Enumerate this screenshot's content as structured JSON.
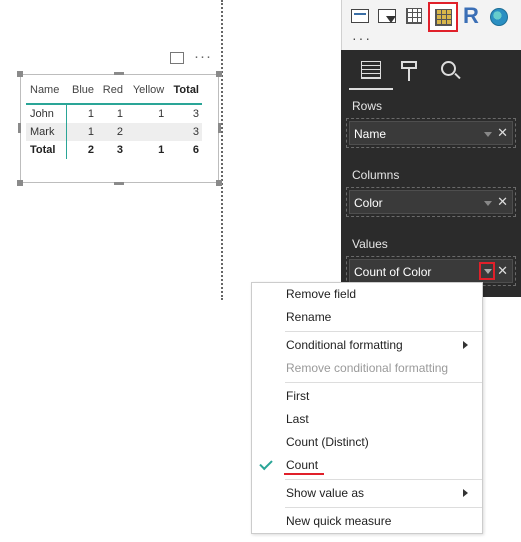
{
  "visual": {
    "matrix": {
      "headers": [
        "Name",
        "Blue",
        "Red",
        "Yellow",
        "Total"
      ],
      "rows": [
        [
          "John",
          "1",
          "1",
          "1",
          "3"
        ],
        [
          "Mark",
          "1",
          "2",
          "",
          "3"
        ]
      ],
      "total_row": [
        "Total",
        "2",
        "3",
        "1",
        "6"
      ]
    },
    "header_icons": {
      "focus": "focus-mode-icon",
      "more": "···"
    }
  },
  "visualizations": {
    "selected": "matrix-icon",
    "r_label": "R",
    "more": "···"
  },
  "fields_pane": {
    "tabs": [
      "fields-tab",
      "format-tab",
      "analytics-tab"
    ],
    "rows_label": "Rows",
    "rows_field": "Name",
    "columns_label": "Columns",
    "columns_field": "Color",
    "values_label": "Values",
    "values_field": "Count of Color",
    "remove_glyph": "✕"
  },
  "context_menu": {
    "remove_field": "Remove field",
    "rename": "Rename",
    "conditional_formatting": "Conditional formatting",
    "remove_conditional_formatting": "Remove conditional formatting",
    "first": "First",
    "last": "Last",
    "count_distinct": "Count (Distinct)",
    "count": "Count",
    "show_value_as": "Show value as",
    "new_quick_measure": "New quick measure",
    "checked_item": "Count"
  },
  "colors": {
    "accent": "#2aa597",
    "highlight": "#e0202a",
    "pane_bg": "#2b2b2b"
  }
}
